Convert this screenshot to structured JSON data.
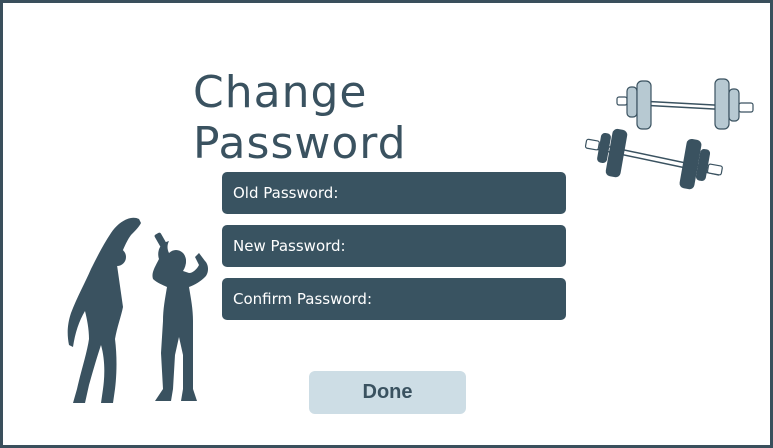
{
  "screen": {
    "title": "Change Password"
  },
  "form": {
    "old_password_label": "Old Password:",
    "new_password_label": "New Password:",
    "confirm_password_label": "Confirm Password:",
    "old_password_value": "",
    "new_password_value": "",
    "confirm_password_value": ""
  },
  "actions": {
    "done_label": "Done"
  },
  "illustrations": {
    "people": "stretching-people-icon",
    "dumbbell_light": "dumbbell-icon",
    "dumbbell_dark": "dumbbell-icon"
  },
  "colors": {
    "frame": "#3a4f5c",
    "title": "#3a5260",
    "field_bg": "#395361",
    "field_text": "#ffffff",
    "done_bg": "#cddde5",
    "dumbbell_light": "#b7c9d2",
    "dumbbell_dark": "#3a5260"
  }
}
